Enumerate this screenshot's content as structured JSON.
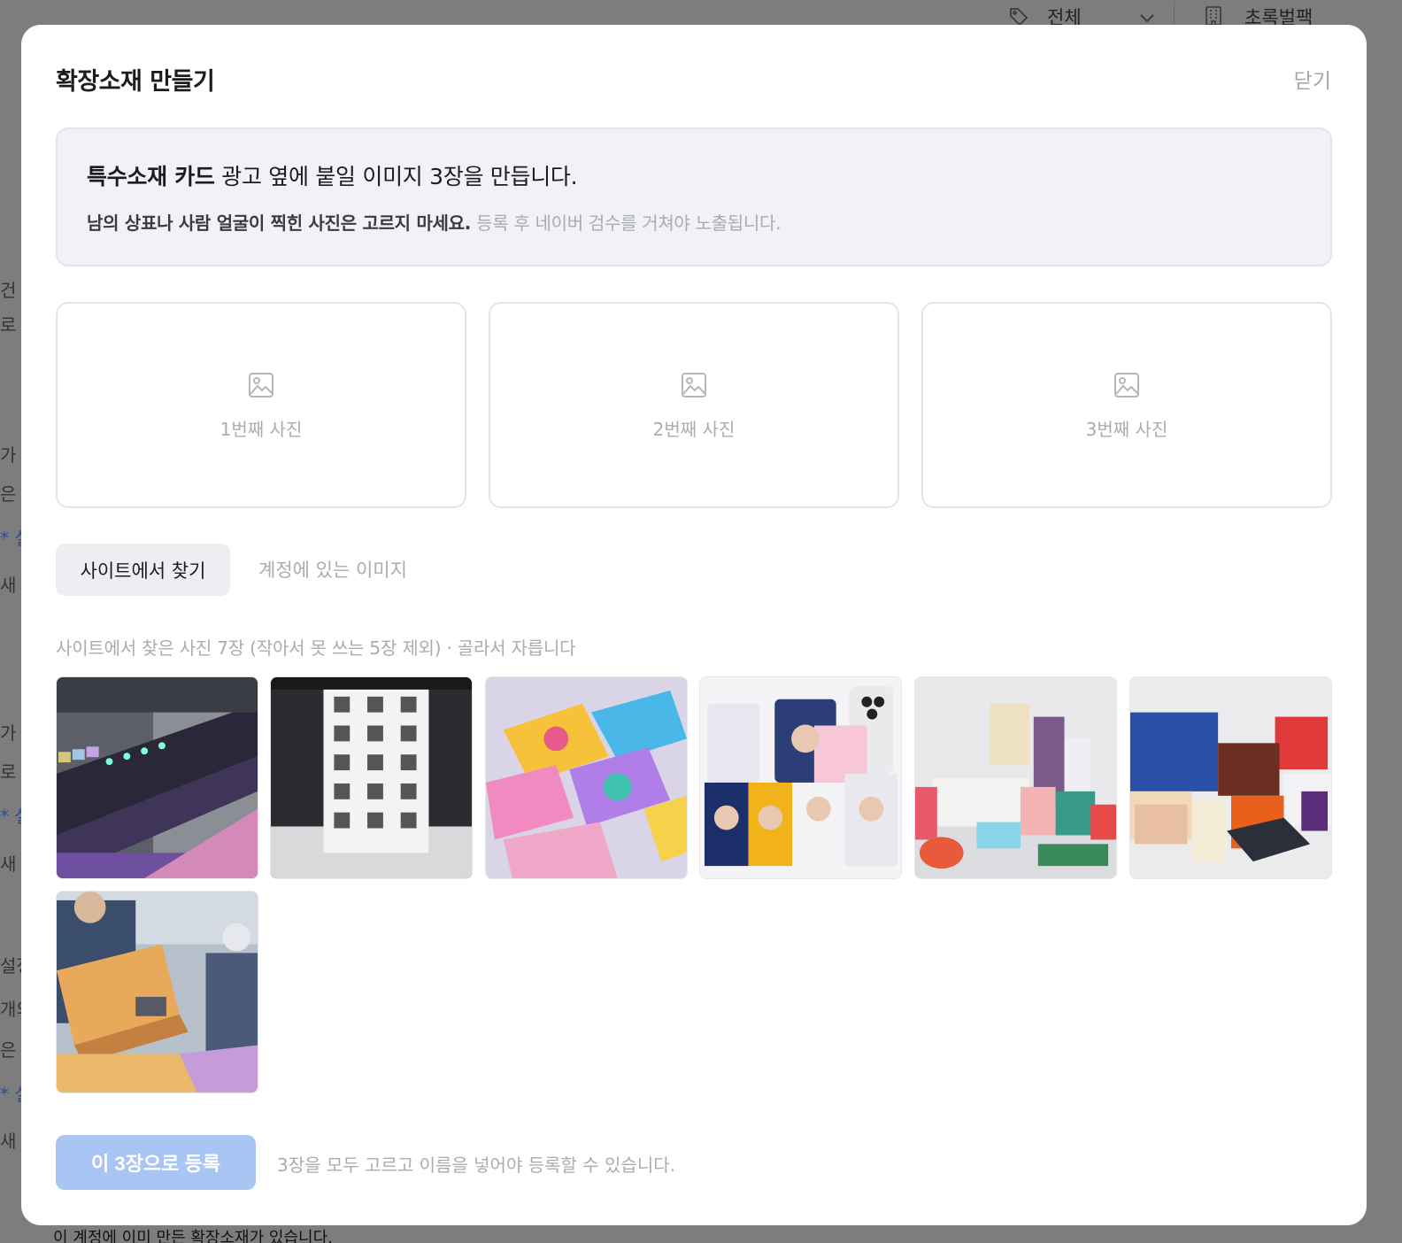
{
  "background": {
    "filter_label": "전체",
    "account_label": "초록벌팩",
    "left_fragments": [
      "건",
      "로 오",
      "가 :",
      "은 사",
      "* 설",
      "새 브",
      "가 사",
      "로",
      "* 설",
      "새 브",
      "설정",
      "개의",
      "은 사",
      "* 설",
      "새 브"
    ],
    "bottom_text": "이 계정에 이미 만든 확장소재가 있습니다."
  },
  "modal": {
    "title": "확장소재 만들기",
    "close_label": "닫기",
    "notice": {
      "strong": "특수소재 카드",
      "line1_rest": " 광고 옆에 붙일 이미지 3장을 만듭니다.",
      "warning": "남의 상표나 사람 얼굴이 찍힌 사진은 고르지 마세요.",
      "review": " 등록 후 네이버 검수를 거쳐야 노출됩니다."
    },
    "slots": [
      {
        "label": "1번째 사진",
        "icon": "image-placeholder-icon"
      },
      {
        "label": "2번째 사진",
        "icon": "image-placeholder-icon"
      },
      {
        "label": "3번째 사진",
        "icon": "image-placeholder-icon"
      }
    ],
    "tabs": {
      "active": "사이트에서 찾기",
      "inactive": "계정에 있는 이미지"
    },
    "found_caption": "사이트에서 찾은 사진 7장 (작아서 못 쓰는 5장 제외) · 골라서 자릅니다",
    "thumbnails": [
      {
        "subject": "printer-head-photo"
      },
      {
        "subject": "qr-label-printing-photo"
      },
      {
        "subject": "colorful-cards-photo"
      },
      {
        "subject": "baseball-photocards-photo"
      },
      {
        "subject": "cosmetic-boxes-photo"
      },
      {
        "subject": "gift-boxes-photo"
      },
      {
        "subject": "factory-worker-box-photo"
      }
    ],
    "submit_label": "이 3장으로 등록",
    "submit_hint": "3장을 모두 고르고 이름을 넣어야 등록할 수 있습니다."
  },
  "colors": {
    "submit_disabled": "#a9c5f3",
    "muted_text": "#a9acb1",
    "overlay": "#7d7d7d"
  }
}
